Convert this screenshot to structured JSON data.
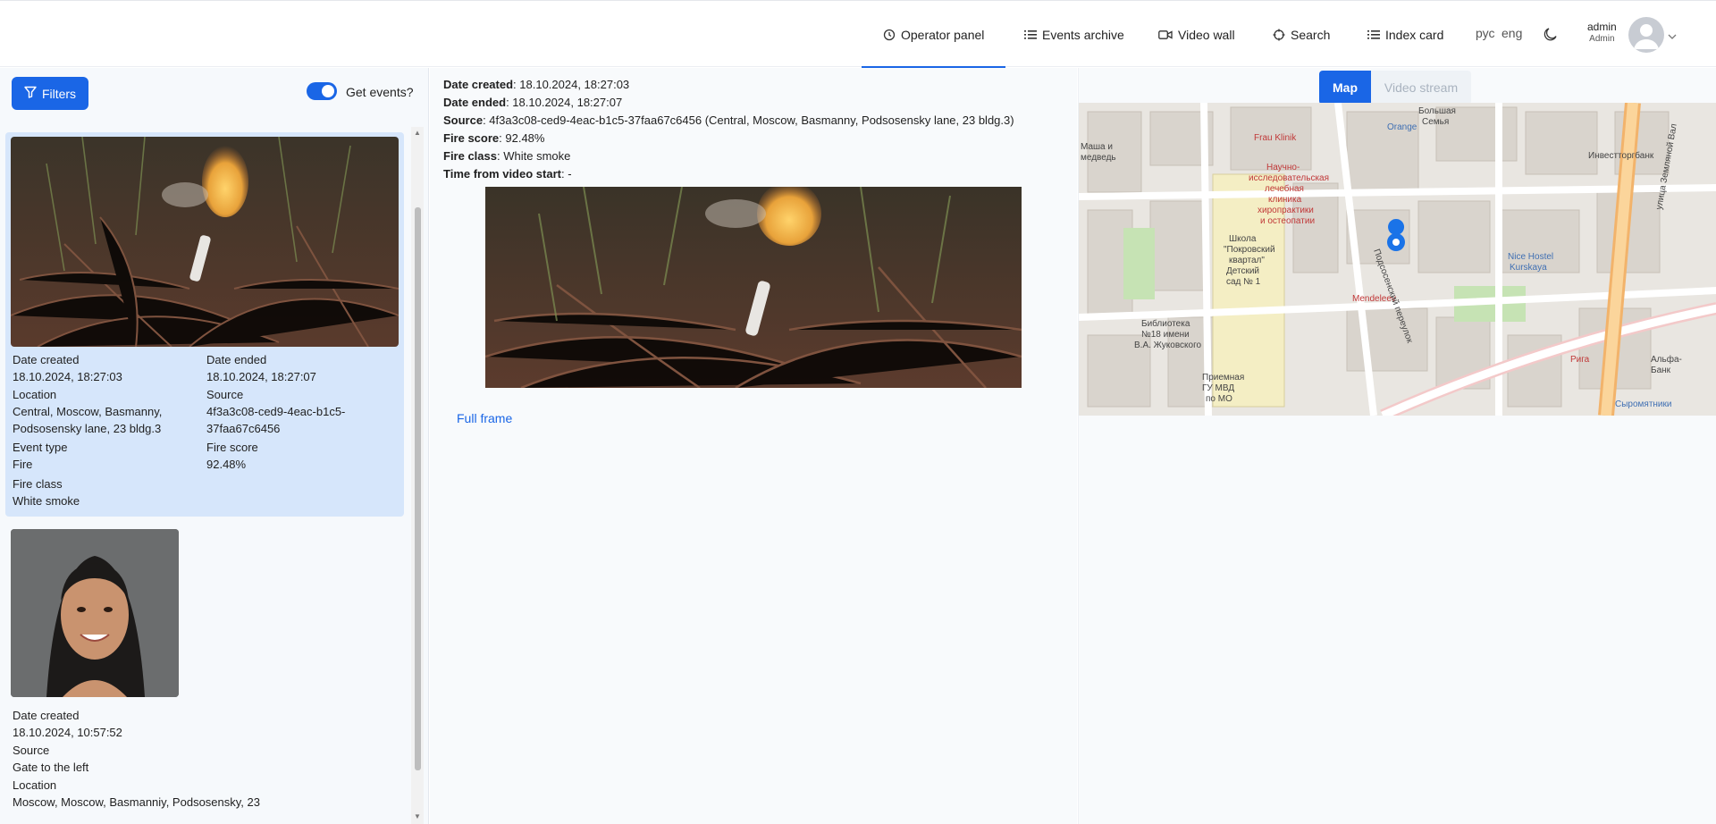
{
  "nav": {
    "operator_panel": "Operator panel",
    "events_archive": "Events archive",
    "video_wall": "Video wall",
    "search": "Search",
    "index_card": "Index card"
  },
  "lang": {
    "ru": "рус",
    "en": "eng"
  },
  "user": {
    "name": "admin",
    "role": "Admin"
  },
  "left": {
    "filters_label": "Filters",
    "get_events_label": "Get events?"
  },
  "cards": [
    {
      "date_created_label": "Date created",
      "date_created": "18.10.2024, 18:27:03",
      "date_ended_label": "Date ended",
      "date_ended": "18.10.2024, 18:27:07",
      "location_label": "Location",
      "location_line1": "Central, Moscow, Basmanny,",
      "location_line2": "Podsosensky lane, 23 bldg.3",
      "source_label": "Source",
      "source_line1": "4f3a3c08-ced9-4eac-b1c5-",
      "source_line2": "37faa67c6456",
      "event_type_label": "Event type",
      "event_type": "Fire",
      "fire_score_label": "Fire score",
      "fire_score": "92.48%",
      "fire_class_label": "Fire class",
      "fire_class": "White smoke"
    },
    {
      "date_created_label": "Date created",
      "date_created": "18.10.2024, 10:57:52",
      "source_label": "Source",
      "source": "Gate to the left",
      "location_label": "Location",
      "location": "Moscow, Moscow, Basmanniy, Podsosensky, 23"
    }
  ],
  "detail": {
    "date_created_label": "Date created",
    "date_created": ": 18.10.2024, 18:27:03",
    "date_ended_label": "Date ended",
    "date_ended": ": 18.10.2024, 18:27:07",
    "source_label": "Source",
    "source": ": 4f3a3c08-ced9-4eac-b1c5-37faa67c6456 (Central, Moscow, Basmanny, Podsosensky lane, 23 bldg.3)",
    "fire_score_label": "Fire score",
    "fire_score": ": 92.48%",
    "fire_class_label": "Fire class",
    "fire_class": ": White smoke",
    "time_label": "Time from video start",
    "time": ": -",
    "full_frame": "Full frame"
  },
  "right": {
    "tab_map": "Map",
    "tab_video": "Video stream"
  },
  "map_labels": {
    "school": "Школа \"Покровский квартал\" Детский сад № 1",
    "street1": "Подсосенский переулок",
    "street2": "улица Земляной Вал",
    "hostel": "Nice Hostel Kurskaya",
    "library": "Библиотека №18 имени В.А. Жуковского",
    "clinic": "Научно-исследовательская лечебная клиника хиропрактики и остеопатии",
    "frau": "Frau Klinik",
    "orange": "Orange",
    "investtorg": "Инвестторгбанк",
    "mendeleev": "Mendeleev",
    "riga": "Рига",
    "alfa": "Альфа-Банк",
    "syromyatniki": "Сыромятники",
    "police": "Приемная ГУ МВД по МО",
    "bolshaya": "Большая Семья",
    "masha": "Маша и медведь"
  },
  "colors": {
    "accent": "#1a66e6",
    "selected_card": "#d6e6fb"
  }
}
